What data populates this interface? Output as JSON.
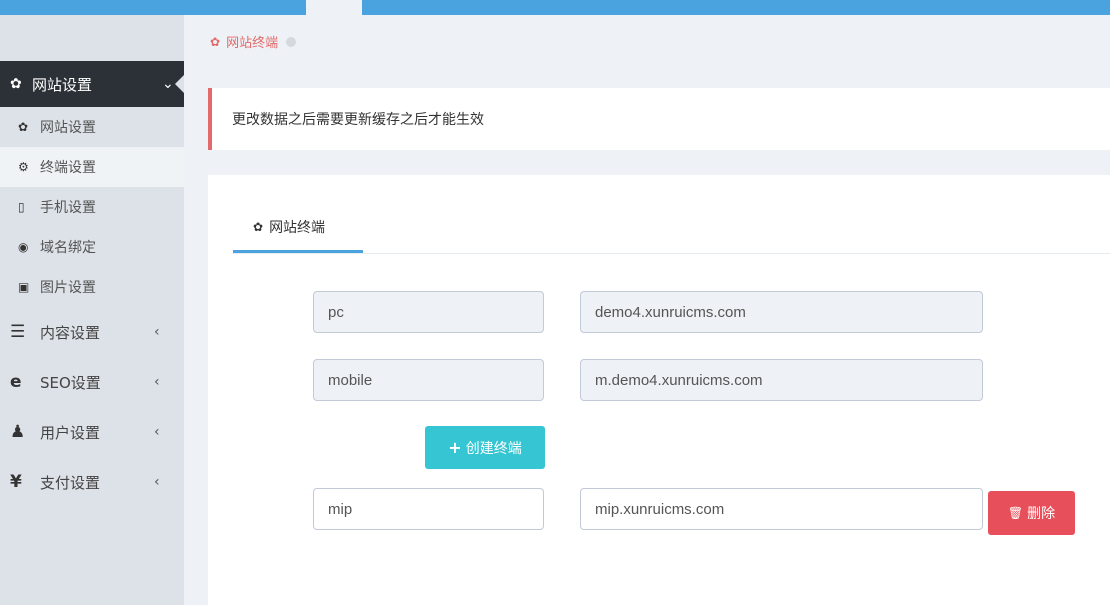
{
  "sidebar": {
    "active_menu": {
      "icon": "gear-icon",
      "label": "网站设置",
      "chevron": "⌄"
    },
    "sub_items": [
      {
        "icon": "gear-icon",
        "glyph": "✿",
        "label": "网站设置"
      },
      {
        "icon": "gears-icon",
        "glyph": "⚙",
        "label": "终端设置"
      },
      {
        "icon": "mobile-icon",
        "glyph": "▯",
        "label": "手机设置"
      },
      {
        "icon": "globe-icon",
        "glyph": "◉",
        "label": "域名绑定"
      },
      {
        "icon": "picture-icon",
        "glyph": "▣",
        "label": "图片设置"
      }
    ],
    "menu_items": [
      {
        "icon": "list-icon",
        "glyph": "☰",
        "label": "内容设置",
        "chevron": "‹"
      },
      {
        "icon": "ie-icon",
        "glyph": "e",
        "label": "SEO设置",
        "chevron": "‹"
      },
      {
        "icon": "user-icon",
        "glyph": "♟",
        "label": "用户设置",
        "chevron": "‹"
      },
      {
        "icon": "yen-icon",
        "glyph": "¥",
        "label": "支付设置",
        "chevron": "‹"
      }
    ]
  },
  "breadcrumb": {
    "icon": "gear-icon",
    "label": "网站终端"
  },
  "notice": {
    "text": "更改数据之后需要更新缓存之后才能生效"
  },
  "panel": {
    "tab": {
      "icon": "gear-icon",
      "label": "网站终端"
    },
    "rows": [
      {
        "name": "pc",
        "domain": "demo4.xunruicms.com"
      },
      {
        "name": "mobile",
        "domain": "m.demo4.xunruicms.com"
      },
      {
        "name": "mip",
        "domain": "mip.xunruicms.com"
      }
    ],
    "create_button": {
      "icon": "plus-icon",
      "label": "创建终端"
    },
    "delete_button": {
      "icon": "trash-icon",
      "label": "删除"
    }
  },
  "colors": {
    "accent": "#4aa3df",
    "danger": "#e7505a",
    "info": "#36c6d3",
    "sidebar_dark": "#2b3137"
  }
}
